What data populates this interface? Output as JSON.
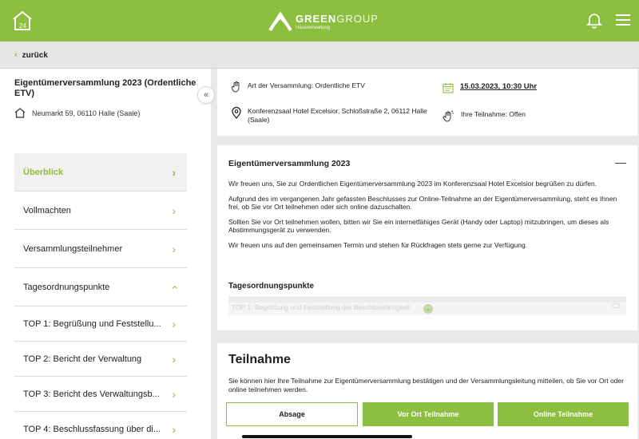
{
  "header": {
    "brand_main": "GREEN",
    "brand_light": "GROUP",
    "brand_sub": "Hausverwaltung",
    "home_icon_text": "24",
    "accent_color": "#8cbf3f"
  },
  "nav": {
    "back_label": "zurück"
  },
  "sidebar": {
    "title": "Eigentümerversammlung 2023 (Ordentliche ETV)",
    "address": "Neumarkt 59, 06110 Halle (Saale)",
    "collapse_label": "«",
    "items": [
      {
        "label": "Überblick",
        "active": true
      },
      {
        "label": "Vollmachten"
      },
      {
        "label": "Versammlungsteilnehmer"
      },
      {
        "label": "Tagesordnungspunkte",
        "expanded": true
      },
      {
        "label": "TOP 1: Begrüßung und Feststellu..."
      },
      {
        "label": "TOP 2: Bericht der Verwaltung"
      },
      {
        "label": "TOP 3: Bericht des Verwaltungsb..."
      },
      {
        "label": "TOP 4: Beschlussfassung über di..."
      }
    ]
  },
  "info": {
    "meeting_type": "Art der Versammlung: Ordentliche ETV",
    "datetime": "15.03.2023, 10:30 Uhr",
    "location": "Konferenzsaal Hotel Excelsior, Schloßstraße 2, 06112 Halle (Saale)",
    "participation": "Ihre Teilnahme: Offen"
  },
  "overview": {
    "title": "Eigentümerversammlung 2023",
    "collapse_symbol": "—",
    "paragraphs": [
      "Wir freuen uns, Sie zur Ordentlichen Eigentümerversammlung 2023 im Konferenzsaal Hotel Excelsior begrüßen zu dürfen.",
      "Aufgrund des im vergangenen Jahr gefassten Beschlusses zur Online-Teilnahme an der Eigentümerversammlung, steht es Ihnen frei, ob Sie vor Ort teilnehmen oder sich online dazuschalten.",
      "Sollten Sie vor Ort teilnehmen wollen, bitten wir Sie ein internetfähiges Gerät (Handy oder Laptop) mitzubringen, um dieses als Abstimmungsgerät zu verwenden.",
      "Wir freuen uns auf den gemeinsamen Termin und stehen für Rückfragen stets gerne zur Verfügung."
    ],
    "agenda_title": "Tagesordnungspunkte",
    "agenda_first": "TOP 1: Begrüßung und Feststellung der Beschlussfähigkeit"
  },
  "participation": {
    "title": "Teilnahme",
    "text": "Sie können hier Ihre Teilnahme zur Eigentümerversammlung bestätigen und der Versammlungsleitung mitteilen, ob Sie vor Ort oder online teilnehmen werden.",
    "decline_label": "Absage",
    "onsite_label": "Vor Ort Teilnahme",
    "online_label": "Online Teilnahme"
  }
}
